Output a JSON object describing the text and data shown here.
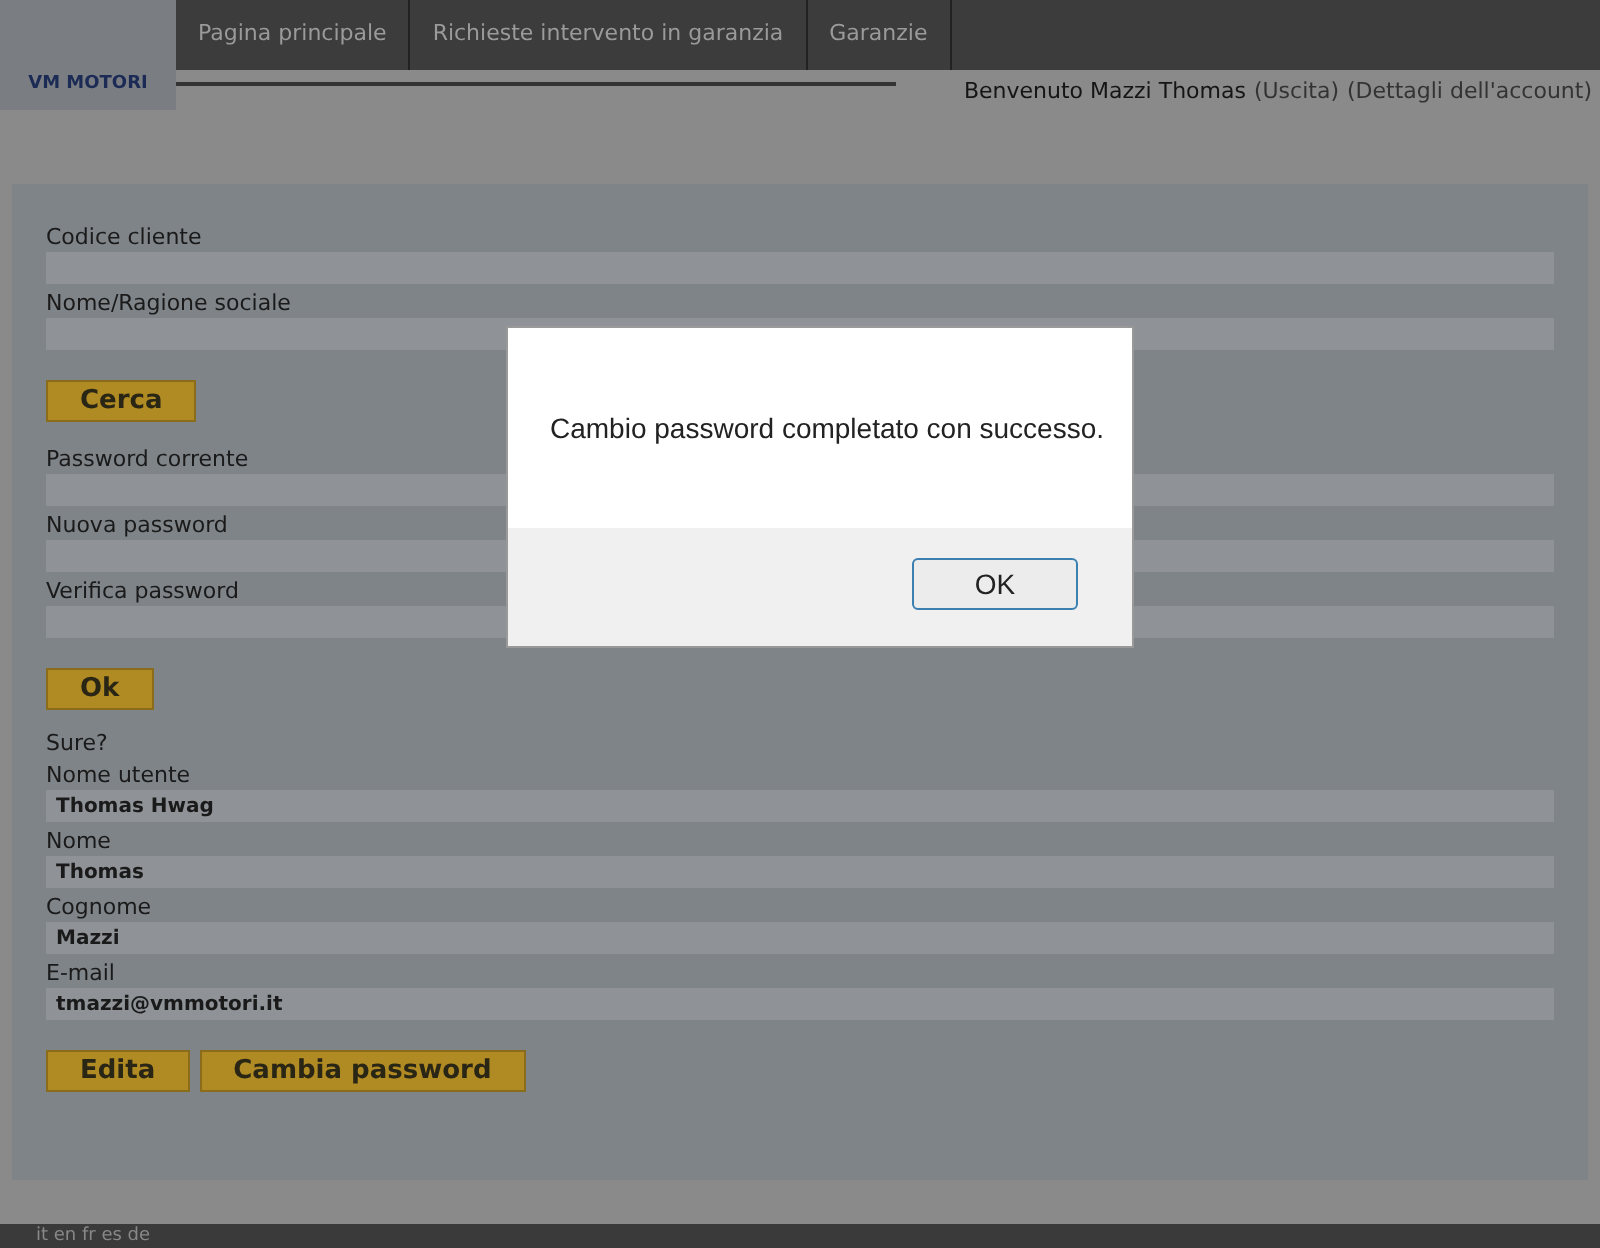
{
  "logo": {
    "text": "VM MOTORI"
  },
  "nav": [
    {
      "label": "Pagina principale"
    },
    {
      "label": "Richieste intervento in garanzia"
    },
    {
      "label": "Garanzie"
    }
  ],
  "account_bar": {
    "welcome": "Benvenuto Mazzi Thomas",
    "links": [
      "(Uscita)",
      "(Dettagli dell'account)"
    ]
  },
  "form": [
    {
      "kind": "field",
      "label": "Codice cliente"
    },
    {
      "kind": "field",
      "label": "Nome/Ragione sociale"
    },
    {
      "kind": "buttons",
      "buttons": [
        "Cerca"
      ]
    },
    {
      "kind": "field",
      "label": "Password corrente"
    },
    {
      "kind": "field",
      "label": "Nuova password"
    },
    {
      "kind": "field",
      "label": "Verifica password"
    },
    {
      "kind": "buttons",
      "buttons": [
        "Ok"
      ]
    },
    {
      "kind": "text",
      "text": "Sure?"
    },
    {
      "kind": "field",
      "label": "Nome utente",
      "value": "Thomas Hwag"
    },
    {
      "kind": "field",
      "label": "Nome",
      "value": "Thomas"
    },
    {
      "kind": "field",
      "label": "Cognome",
      "value": "Mazzi"
    },
    {
      "kind": "field",
      "label": "E-mail",
      "value": "tmazzi@vmmotori.it"
    },
    {
      "kind": "buttons",
      "buttons": [
        "Edita",
        "Cambia password"
      ]
    }
  ],
  "languages": "it en fr es de",
  "dialog": {
    "message": "Cambio password completato con successo.",
    "button": "OK"
  }
}
